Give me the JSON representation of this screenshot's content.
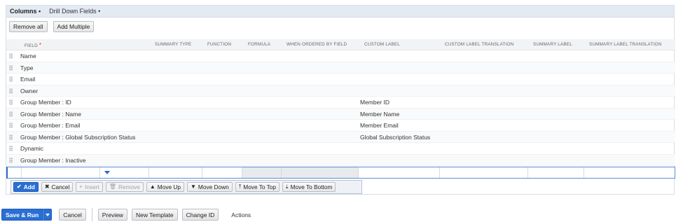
{
  "tabs": [
    {
      "label": "Columns •"
    },
    {
      "label": "Drill Down Fields •"
    }
  ],
  "toolbar": {
    "remove_all": "Remove all",
    "add_multiple": "Add Multiple"
  },
  "columns": {
    "field": "FIELD",
    "required_mark": "*",
    "summary_type": "SUMMARY TYPE",
    "function": "FUNCTION",
    "formula": "FORMULA",
    "when_ordered_by_field": "WHEN ORDERED BY FIELD",
    "custom_label": "CUSTOM LABEL",
    "custom_label_translation": "CUSTOM LABEL TRANSLATION",
    "summary_label": "SUMMARY LABEL",
    "summary_label_translation": "SUMMARY LABEL TRANSLATION"
  },
  "rows": [
    {
      "field": "Name",
      "custom_label": ""
    },
    {
      "field": "Type",
      "custom_label": ""
    },
    {
      "field": "Email",
      "custom_label": ""
    },
    {
      "field": "Owner",
      "custom_label": ""
    },
    {
      "field": "Group Member : ID",
      "custom_label": "Member ID"
    },
    {
      "field": "Group Member : Name",
      "custom_label": "Member Name"
    },
    {
      "field": "Group Member : Email",
      "custom_label": "Member Email"
    },
    {
      "field": "Group Member : Global Subscription Status",
      "custom_label": "Global Subscription Status"
    },
    {
      "field": "Dynamic",
      "custom_label": ""
    },
    {
      "field": "Group Member : Inactive",
      "custom_label": ""
    }
  ],
  "row_actions": {
    "add": "Add",
    "cancel": "Cancel",
    "insert": "Insert",
    "remove": "Remove",
    "move_up": "Move Up",
    "move_down": "Move Down",
    "move_to_top": "Move To Top",
    "move_to_bottom": "Move To Bottom"
  },
  "footer": {
    "save_run": "Save & Run",
    "cancel": "Cancel",
    "preview": "Preview",
    "new_template": "New Template",
    "change_id": "Change ID",
    "actions": "Actions"
  },
  "colors": {
    "primary": "#2a6fd4",
    "tabbar": "#e4eaf2",
    "required": "#d9372b"
  }
}
